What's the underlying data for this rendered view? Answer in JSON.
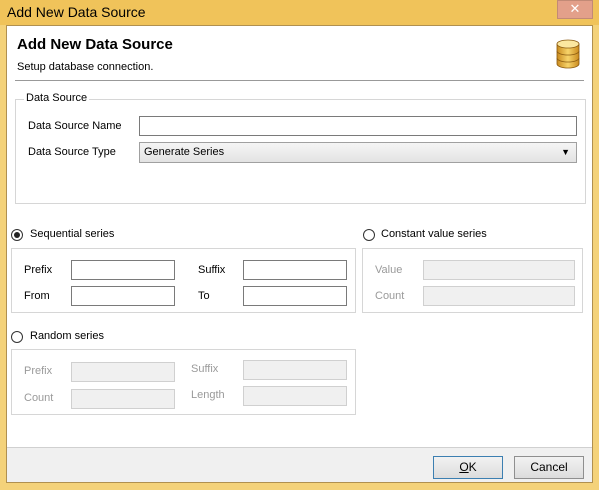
{
  "window": {
    "title": "Add New Data Source",
    "close_glyph": "✕"
  },
  "header": {
    "title": "Add New Data Source",
    "subtitle": "Setup database connection.",
    "icon": "database-icon"
  },
  "data_source": {
    "group_label": "Data Source",
    "name_label": "Data Source Name",
    "name_value": "",
    "type_label": "Data Source Type",
    "type_value": "Generate Series"
  },
  "sequential": {
    "label": "Sequential series",
    "selected": true,
    "prefix_label": "Prefix",
    "suffix_label": "Suffix",
    "from_label": "From",
    "to_label": "To"
  },
  "constant": {
    "label": "Constant value series",
    "selected": false,
    "value_label": "Value",
    "count_label": "Count"
  },
  "random": {
    "label": "Random series",
    "selected": false,
    "prefix_label": "Prefix",
    "suffix_label": "Suffix",
    "count_label": "Count",
    "length_label": "Length"
  },
  "buttons": {
    "ok_mnemonic": "O",
    "ok_rest": "K",
    "cancel": "Cancel"
  }
}
